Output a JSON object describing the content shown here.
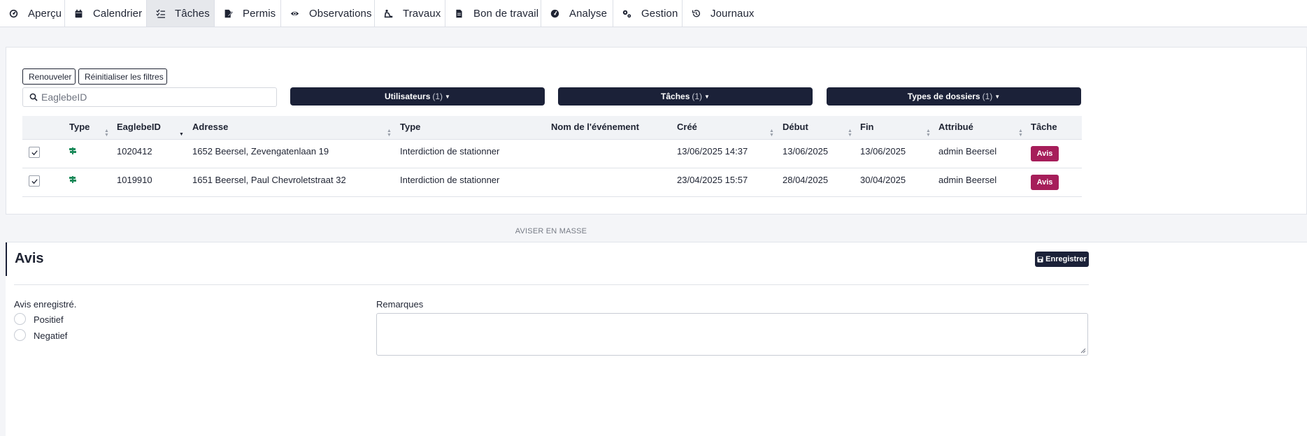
{
  "nav": {
    "tabs": [
      {
        "label": "Aperçu",
        "icon": "dashboard-icon"
      },
      {
        "label": "Calendrier",
        "icon": "calendar-icon"
      },
      {
        "label": "Tâches",
        "icon": "tasks-icon",
        "active": true
      },
      {
        "label": "Permis",
        "icon": "permit-icon"
      },
      {
        "label": "Observations",
        "icon": "eye-icon"
      },
      {
        "label": "Travaux",
        "icon": "roadworks-icon"
      },
      {
        "label": "Bon de travail",
        "icon": "document-icon"
      },
      {
        "label": "Analyse",
        "icon": "gauge-icon"
      },
      {
        "label": "Gestion",
        "icon": "gears-icon"
      },
      {
        "label": "Journaux",
        "icon": "history-icon"
      }
    ]
  },
  "filters": {
    "refresh_label": "Renouveler",
    "reset_label": "Réinitialiser les filtres",
    "search_placeholder": "EaglebeID",
    "users": {
      "label": "Utilisateurs",
      "count": "(1)"
    },
    "tasks": {
      "label": "Tâches",
      "count": "(1)"
    },
    "folder_types": {
      "label": "Types de dossiers",
      "count": "(1)"
    }
  },
  "table": {
    "headers": {
      "type": "Type",
      "eaglebe_id": "EaglebeID",
      "address": "Adresse",
      "type2": "Type",
      "event_name": "Nom de l'événement",
      "created": "Créé",
      "start": "Début",
      "end": "Fin",
      "assigned": "Attribué",
      "task": "Tâche"
    },
    "rows": [
      {
        "id": "1020412",
        "address": "1652 Beersel, Zevengatenlaan 19",
        "type": "Interdiction de stationner",
        "event_name": "",
        "created": "13/06/2025 14:37",
        "start": "13/06/2025",
        "end": "13/06/2025",
        "assigned": "admin Beersel",
        "task_label": "Avis"
      },
      {
        "id": "1019910",
        "address": "1651 Beersel, Paul Chevroletstraat 32",
        "type": "Interdiction de stationner",
        "event_name": "",
        "created": "23/04/2025 15:57",
        "start": "28/04/2025",
        "end": "30/04/2025",
        "assigned": "admin Beersel",
        "task_label": "Avis"
      }
    ]
  },
  "bulk_label": "AVISER EN MASSE",
  "avis": {
    "title": "Avis",
    "save_label": "Enregistrer",
    "status_label": "Avis enregistré.",
    "options": [
      "Positief",
      "Negatief"
    ],
    "remarks_label": "Remarques"
  },
  "colors": {
    "primary": "#1b2138",
    "accent": "#a61e5a",
    "type_icon": "#1a8a5a"
  }
}
